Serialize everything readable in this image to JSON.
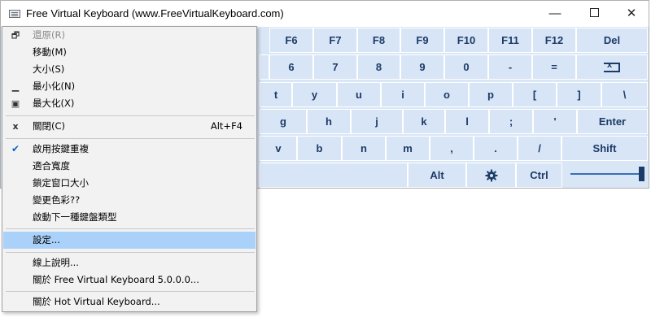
{
  "window": {
    "title": "Free Virtual Keyboard (www.FreeVirtualKeyboard.com)",
    "min_symbol": "—",
    "close_symbol": "✕"
  },
  "keyboard": {
    "row1": [
      "F6",
      "F7",
      "F8",
      "F9",
      "F10",
      "F11",
      "F12",
      "Del"
    ],
    "row2": [
      "6",
      "7",
      "8",
      "9",
      "0",
      "-",
      "="
    ],
    "row3": [
      "t",
      "y",
      "u",
      "i",
      "o",
      "p",
      "[",
      "]",
      "\\"
    ],
    "row4": [
      "g",
      "h",
      "j",
      "k",
      "l",
      ";",
      "'",
      "Enter"
    ],
    "row5": [
      "v",
      "b",
      "n",
      "m",
      ",",
      ".",
      "/",
      "Shift"
    ],
    "row6": [
      "Alt",
      "Ctrl"
    ],
    "settings_icon": "gear-icon",
    "backspace_icon": "backspace-icon"
  },
  "menu": {
    "restore": "還原(R)",
    "move": "移動(M)",
    "size": "大小(S)",
    "minimize": "最小化(N)",
    "maximize": "最大化(X)",
    "close": "關閉(C)",
    "close_shortcut": "Alt+F4",
    "repeat": "啟用按鍵重複",
    "fit_width": "適合寬度",
    "lock_size": "鎖定窗口大小",
    "change_color": "變更色彩??",
    "next_type": "啟動下一種鍵盤類型",
    "settings": "設定...",
    "help": "線上說明...",
    "about_free": "關於 Free Virtual Keyboard 5.0.0.0...",
    "about_hot": "關於 Hot Virtual Keyboard..."
  },
  "colors": {
    "key_bg": "#d8e5f7",
    "key_text": "#1c3b66",
    "highlight": "#aad1f9"
  }
}
